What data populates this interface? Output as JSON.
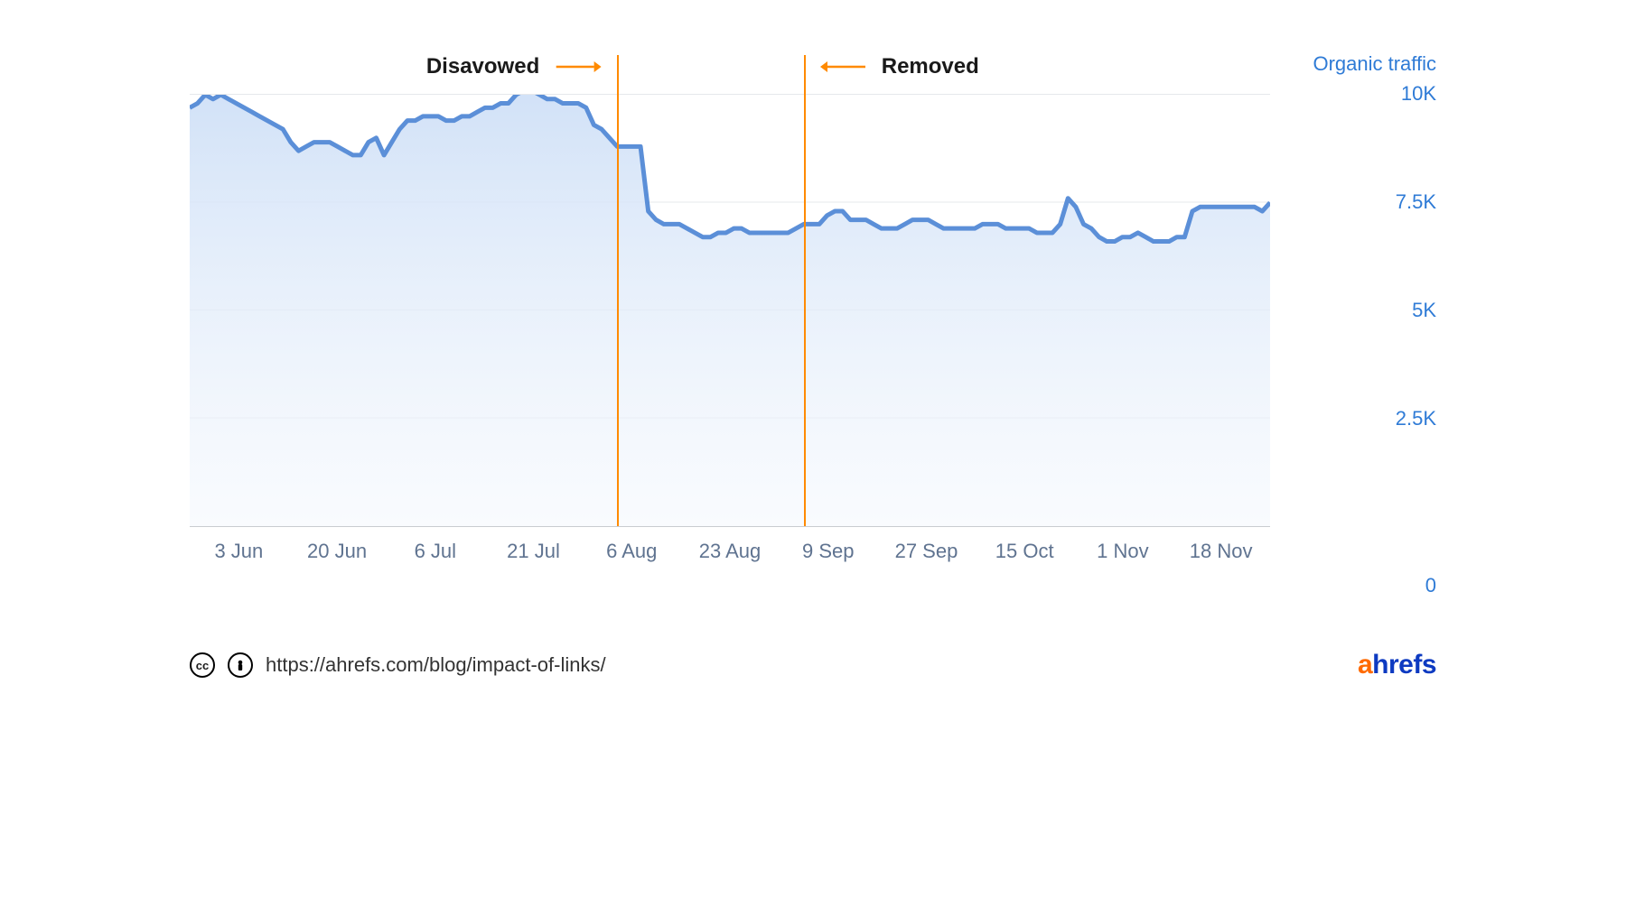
{
  "chart_data": {
    "type": "area",
    "title": "",
    "xlabel": "",
    "ylabel": "Organic traffic",
    "ylim": [
      0,
      10000
    ],
    "x_ticks": [
      "3 Jun",
      "20 Jun",
      "6 Jul",
      "21 Jul",
      "6 Aug",
      "23 Aug",
      "9 Sep",
      "27 Sep",
      "15 Oct",
      "1 Nov",
      "18 Nov"
    ],
    "y_ticks": [
      {
        "v": 10000,
        "label": "10K"
      },
      {
        "v": 7500,
        "label": "7.5K"
      },
      {
        "v": 5000,
        "label": "5K"
      },
      {
        "v": 2500,
        "label": "2.5K"
      },
      {
        "v": 0,
        "label": "0"
      }
    ],
    "series": [
      {
        "name": "Organic traffic",
        "x": [
          0,
          1,
          2,
          3,
          4,
          5,
          6,
          7,
          8,
          9,
          10,
          11,
          12,
          13,
          14,
          15,
          16,
          17,
          18,
          19,
          20,
          21,
          22,
          23,
          24,
          25,
          26,
          27,
          28,
          29,
          30,
          31,
          32,
          33,
          34,
          35,
          36,
          37,
          38,
          39,
          40,
          41,
          42,
          43,
          44,
          45,
          46,
          47,
          48,
          49,
          50,
          51,
          52,
          53,
          54,
          55,
          56,
          57,
          58,
          59,
          60,
          61,
          62,
          63,
          64,
          65,
          66,
          67,
          68,
          69,
          70,
          71,
          72,
          73,
          74,
          75,
          76,
          77,
          78,
          79,
          80,
          81,
          82,
          83,
          84,
          85,
          86,
          87,
          88,
          89,
          90,
          91,
          92,
          93,
          94,
          95,
          96,
          97,
          98,
          99,
          100,
          101,
          102,
          103,
          104,
          105,
          106,
          107,
          108,
          109,
          110,
          111,
          112,
          113,
          114,
          115,
          116,
          117,
          118,
          119,
          120,
          121,
          122,
          123,
          124,
          125,
          126,
          127,
          128,
          129,
          130,
          131,
          132,
          133,
          134,
          135,
          136,
          137,
          138,
          139
        ],
        "values": [
          9700,
          9800,
          10000,
          9900,
          10000,
          9900,
          9800,
          9700,
          9600,
          9500,
          9400,
          9300,
          9200,
          8900,
          8700,
          8800,
          8900,
          8900,
          8900,
          8800,
          8700,
          8600,
          8600,
          8900,
          9000,
          8600,
          8900,
          9200,
          9400,
          9400,
          9500,
          9500,
          9500,
          9400,
          9400,
          9500,
          9500,
          9600,
          9700,
          9700,
          9800,
          9800,
          10000,
          10100,
          10100,
          10000,
          9900,
          9900,
          9800,
          9800,
          9800,
          9700,
          9300,
          9200,
          9000,
          8800,
          8800,
          8800,
          8800,
          7300,
          7100,
          7000,
          7000,
          7000,
          6900,
          6800,
          6700,
          6700,
          6800,
          6800,
          6900,
          6900,
          6800,
          6800,
          6800,
          6800,
          6800,
          6800,
          6900,
          7000,
          7000,
          7000,
          7200,
          7300,
          7300,
          7100,
          7100,
          7100,
          7000,
          6900,
          6900,
          6900,
          7000,
          7100,
          7100,
          7100,
          7000,
          6900,
          6900,
          6900,
          6900,
          6900,
          7000,
          7000,
          7000,
          6900,
          6900,
          6900,
          6900,
          6800,
          6800,
          6800,
          7000,
          7600,
          7400,
          7000,
          6900,
          6700,
          6600,
          6600,
          6700,
          6700,
          6800,
          6700,
          6600,
          6600,
          6600,
          6700,
          6700,
          7300,
          7400,
          7400,
          7400,
          7400,
          7400,
          7400,
          7400,
          7400,
          7300,
          7500
        ]
      }
    ],
    "annotations": [
      {
        "label": "Disavowed",
        "x": 55,
        "side": "left"
      },
      {
        "label": "Removed",
        "x": 79,
        "side": "right"
      }
    ]
  },
  "footer": {
    "url": "https://ahrefs.com/blog/impact-of-links/",
    "cc_label": "cc",
    "by_label": "🛈",
    "brand_a": "a",
    "brand_rest": "hrefs"
  }
}
